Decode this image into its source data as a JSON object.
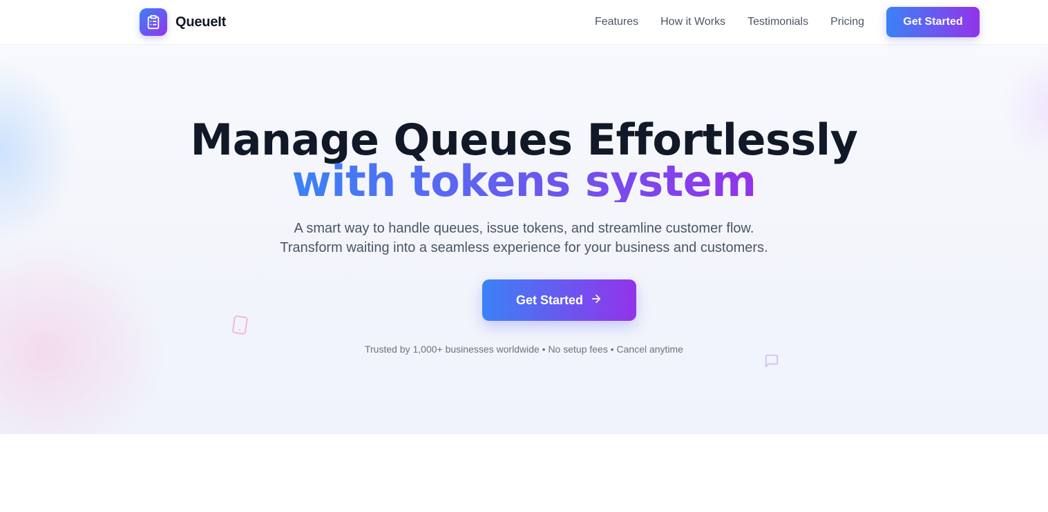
{
  "brand": {
    "name": "QueueIt",
    "logo_icon": "clipboard-list-icon"
  },
  "nav": {
    "links": [
      "Features",
      "How it Works",
      "Testimonials",
      "Pricing"
    ],
    "cta_label": "Get Started"
  },
  "hero": {
    "headline_line1": "Manage Queues Effortlessly",
    "headline_line2": "with tokens system",
    "subtext_line1": "A smart way to handle queues, issue tokens, and streamline customer flow.",
    "subtext_line2": "Transform waiting into a seamless experience for your business and customers.",
    "cta_label": "Get Started",
    "cta_icon": "arrow-right-icon",
    "trust_text": "Trusted by 1,000+ businesses worldwide • No setup fees • Cancel anytime",
    "decorations": [
      "smartphone-icon",
      "message-square-icon"
    ]
  },
  "colors": {
    "gradient_start": "#3b82f6",
    "gradient_end": "#9333ea",
    "heading": "#111827",
    "body_text": "#4b5563",
    "muted_text": "#6b7280"
  }
}
